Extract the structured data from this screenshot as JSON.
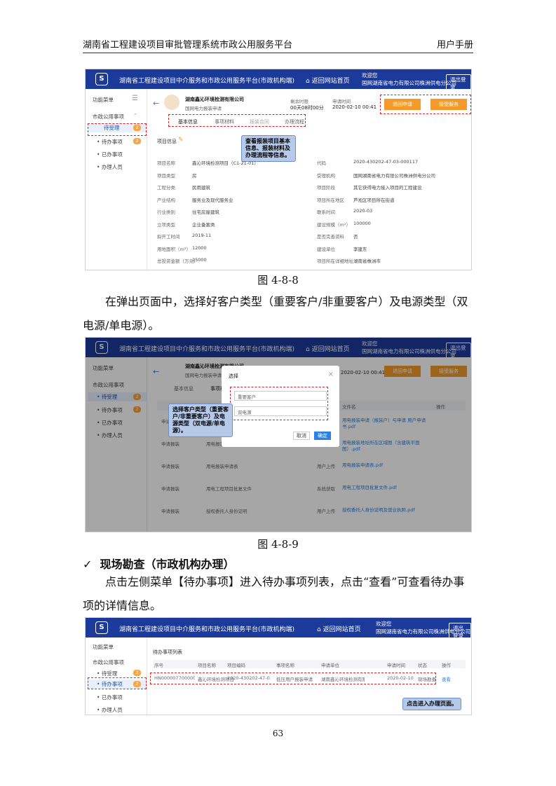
{
  "header": {
    "left": "湖南省工程建设项目审批管理系统市政公用服务平台",
    "right": "用户手册"
  },
  "app": {
    "title": "湖南省工程建设项目中介服务和市政公用服务平台(市政机构端)",
    "home": "返回网站首页",
    "welcome": "欢迎您",
    "org": "国网湖南省电力有限公司株洲供电分公司",
    "logout": "退出登录",
    "menu_label": "功能菜单",
    "group": "市政公用事项",
    "pending_todo": "待受理",
    "todo": "待办事项",
    "done": "已办事项",
    "staff": "办理人员"
  },
  "fig1": {
    "company": "湖南鑫沁环境检测有限公司",
    "company_sub": "国网电力报装申请",
    "time_label": "剩余时限",
    "time_value": "00天08时00分",
    "apply_label": "申请时间",
    "apply_value": "2020-02-10 00:41",
    "btn_reject": "退回申请",
    "btn_accept": "接受服务",
    "tabs": [
      "基本信息",
      "事项材料",
      "报装合同",
      "办理流程"
    ],
    "section": "项目信息",
    "callout": "查看报装项目基本信息、报装材料及办理流程等信息。",
    "left_rows": [
      [
        "项目名称",
        "鑫沁环境检测项目（C1-21-01）"
      ],
      [
        "项目类型",
        "房"
      ],
      [
        "工程分类",
        "民用建筑"
      ],
      [
        "产业结构",
        "服务业及现代服务业"
      ],
      [
        "行业类别",
        "住宅房屋建筑"
      ],
      [
        "立项类型",
        "企业备案类"
      ],
      [
        "拟开工时间",
        "2019-11"
      ],
      [
        "用地面积（m²）",
        "12000"
      ],
      [
        "总投资金额（万元）",
        "25000"
      ]
    ],
    "right_rows": [
      [
        "代码",
        "2020-430202-47-03-000117"
      ],
      [
        "受理机构",
        "国网湖南省电力有限公司株洲供电分公司"
      ],
      [
        "项目阶段",
        "其它获得电力接入项目的工程建设"
      ],
      [
        "项目所在地区",
        "芦淞区项目所在街道"
      ],
      [
        "联系时间",
        "2020-03"
      ],
      [
        "建设规模（m²）",
        "100000"
      ],
      [
        "是否完善资料",
        "否"
      ],
      [
        "建设单位",
        "李建东"
      ],
      [
        "项目所在详细地址",
        "湖南省株洲市"
      ]
    ]
  },
  "cap1": "图 4-8-8",
  "para1": "在弹出页面中，选择好客户类型（重要客户/非重要客户）及电源类型（双电源/单电源）。",
  "fig2": {
    "dialog_title": "选择",
    "opt1": "重要客户",
    "opt2": "双电源",
    "cancel": "取消",
    "ok": "确定",
    "callout": "选择客户类型（重要客户/非重要客户）及电源类型（双电源/单电源）。",
    "col_file": "文件名",
    "col_op": "操作",
    "rows": [
      [
        "申请报装",
        "用电报装申请",
        "用户上传",
        "用电报装申请（报装户）与申请 用户申请书.pdf"
      ],
      [
        "申请报装",
        "用电报装地址所在区域图（含建筑平面图）",
        "用户上传",
        "用电报装地址所在区域图（含建筑平面图）.pdf"
      ],
      [
        "申请报装",
        "用电报装申请表",
        "用户上传",
        "用电报装申请表.pdf"
      ],
      [
        "申请报装",
        "用电工程项目批复文件",
        "系统获取",
        "用电工程项目批复文件.pdf"
      ],
      [
        "申请报装",
        "授权委托人身份证明",
        "用户上传",
        "授权委托人身份证明及营业执照.pdf"
      ]
    ]
  },
  "cap2": "图 4-8-9",
  "heading": "现场勘查（市政机构办理）",
  "para2": "点击左侧菜单【待办事项】进入待办事项列表，点击“查看”可查看待办事项的详情信息。",
  "fig3": {
    "section": "待办事项列表",
    "cols": [
      "序号",
      "项目名称",
      "项目编码",
      "事项名称",
      "申请单位",
      "申请时间",
      "状态",
      "操作"
    ],
    "row": [
      "HN00000770000010",
      "鑫沁环境检测项目",
      "2020-430202-47-03",
      "低压用户报装申请",
      "湖南鑫沁环境检测有限公司",
      "2020-02-10",
      "现场勘查",
      "查看"
    ],
    "callout": "点击进入办理页面。"
  },
  "page_number": "63"
}
